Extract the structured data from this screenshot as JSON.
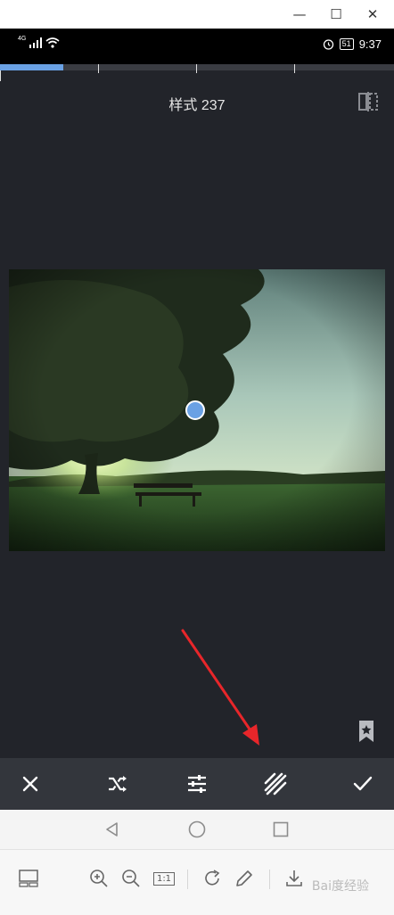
{
  "window": {
    "minimize": "—",
    "maximize": "☐",
    "close": "✕"
  },
  "status_bar": {
    "network": "4G",
    "battery": "51",
    "time": "9:37"
  },
  "editor": {
    "title": "样式 237",
    "progress_fraction": 0.16
  },
  "toolbar": {
    "cancel_icon": "close-icon",
    "shuffle_icon": "shuffle-icon",
    "adjust_icon": "sliders-icon",
    "texture_icon": "stripes-icon",
    "confirm_icon": "check-icon"
  },
  "nav": {
    "back_icon": "triangle-back-icon",
    "home_icon": "circle-home-icon",
    "recent_icon": "square-recents-icon"
  },
  "viewer": {
    "ratio_label": "1:1",
    "watermark": "Bai度经验"
  },
  "colors": {
    "accent": "#6aa1e4",
    "app_bg": "#22242a",
    "toolbar_bg": "#33363c",
    "arrow": "#e8262a"
  }
}
